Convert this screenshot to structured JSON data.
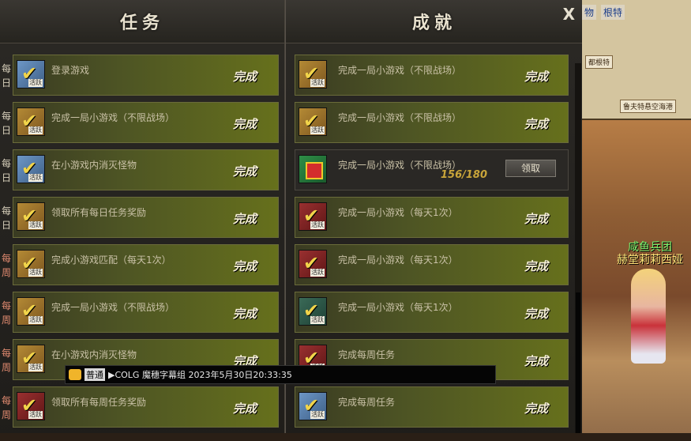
{
  "tasks_panel": {
    "title": "任务",
    "rows": [
      {
        "freq": "每日",
        "freq_type": "daily",
        "text": "登录游戏",
        "status": "完成"
      },
      {
        "freq": "每日",
        "freq_type": "daily",
        "text": "完成一局小游戏（不限战场）",
        "status": "完成"
      },
      {
        "freq": "每日",
        "freq_type": "daily",
        "text": "在小游戏内消灭怪物",
        "status": "完成"
      },
      {
        "freq": "每日",
        "freq_type": "daily",
        "text": "领取所有每日任务奖励",
        "status": "完成"
      },
      {
        "freq": "每周",
        "freq_type": "weekly",
        "text": "完成小游戏匹配（每天1次）",
        "status": "完成"
      },
      {
        "freq": "每周",
        "freq_type": "weekly",
        "text": "完成一局小游戏（不限战场）",
        "status": "完成"
      },
      {
        "freq": "每周",
        "freq_type": "weekly",
        "text": "在小游戏内消灭怪物",
        "status": "完成"
      },
      {
        "freq": "每周",
        "freq_type": "weekly",
        "text": "领取所有每周任务奖励",
        "status": "完成"
      }
    ]
  },
  "achievements_panel": {
    "title": "成就",
    "close_label": "X",
    "rows": [
      {
        "text": "完成一局小游戏（不限战场）",
        "status": "完成",
        "icon": "t-b"
      },
      {
        "text": "完成一局小游戏（不限战场）",
        "status": "完成",
        "icon": "t-b"
      },
      {
        "text": "完成一局小游戏（不限战场）",
        "progress": "156/180",
        "button": "领取",
        "icon": "t-gift"
      },
      {
        "text": "完成一局小游戏（每天1次）",
        "status": "完成",
        "icon": "t-c"
      },
      {
        "text": "完成一局小游戏（每天1次）",
        "status": "完成",
        "icon": "t-c"
      },
      {
        "text": "完成一局小游戏（每天1次）",
        "status": "完成",
        "icon": "t-d"
      },
      {
        "text": "完成每周任务",
        "status": "完成",
        "icon": "t-c"
      },
      {
        "text": "完成每周任务",
        "status": "完成",
        "icon": "t-a"
      }
    ]
  },
  "icon_badge": "活跃",
  "minimap": {
    "tab1": "物",
    "tab2": "根特",
    "label1": "都根特",
    "label2": "鲁夫特悬空海港"
  },
  "npc": {
    "guild": "咸鱼兵团",
    "name": "赫堂莉莉西娅"
  },
  "chat": {
    "channel": "普通",
    "message": "▶COLG 魔穗字幕组  2023年5月30日20:33:35"
  }
}
